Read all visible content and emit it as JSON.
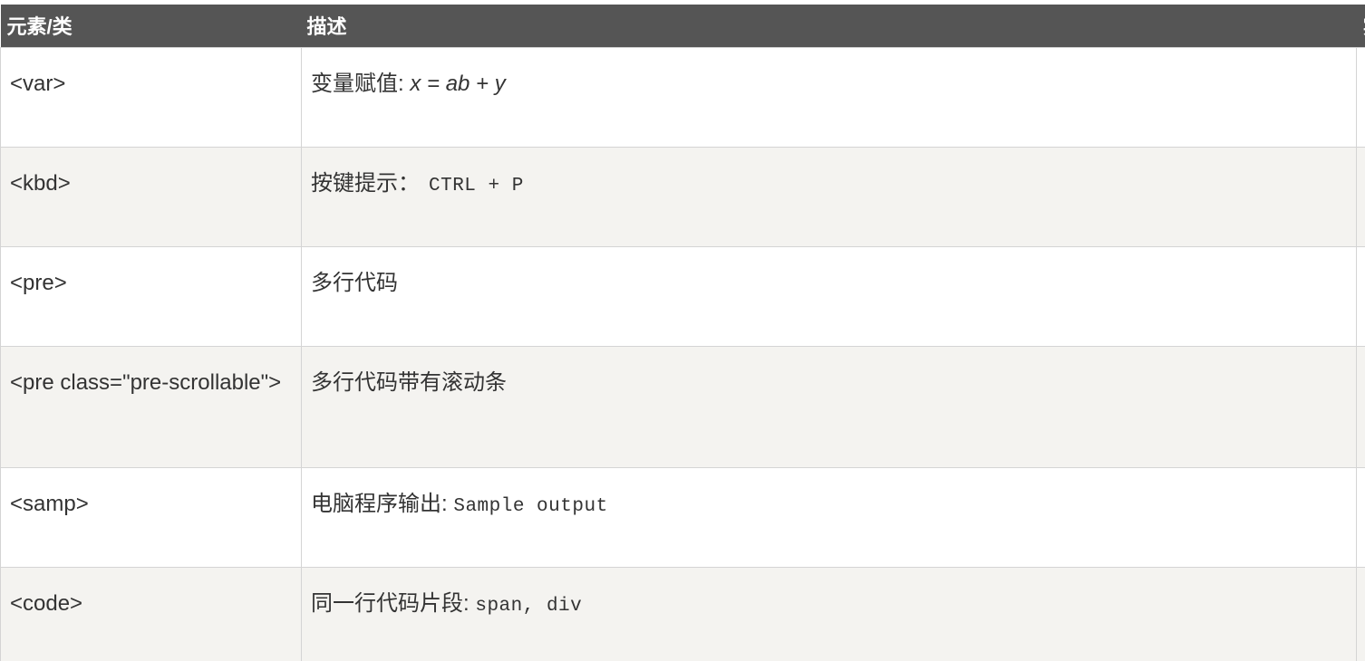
{
  "header": {
    "col1": "元素/类",
    "col2": "描述",
    "col3": "实"
  },
  "rows": [
    {
      "element": "<var>",
      "desc_label": "变量赋值: ",
      "desc_sample": "x = ab + y",
      "sample_style": "italic"
    },
    {
      "element": "<kbd>",
      "desc_label": "按键提示：",
      "desc_sample": "CTRL + P",
      "sample_style": "monospace"
    },
    {
      "element": "<pre>",
      "desc_label": "多行代码",
      "desc_sample": "",
      "sample_style": "none"
    },
    {
      "element": "<pre class=\"pre-scrollable\">",
      "desc_label": "多行代码带有滚动条",
      "desc_sample": "",
      "sample_style": "none"
    },
    {
      "element": "<samp>",
      "desc_label": "电脑程序输出: ",
      "desc_sample": "Sample output",
      "sample_style": "monospace"
    },
    {
      "element": "<code>",
      "desc_label": "同一行代码片段: ",
      "desc_sample": "span, div",
      "sample_style": "monospace"
    }
  ],
  "colors": {
    "header_bg": "#555555",
    "header_text": "#ffffff",
    "row_alt_bg": "#f4f3f0",
    "row_bg": "#ffffff",
    "border": "#d4d4d4",
    "text": "#333333"
  }
}
